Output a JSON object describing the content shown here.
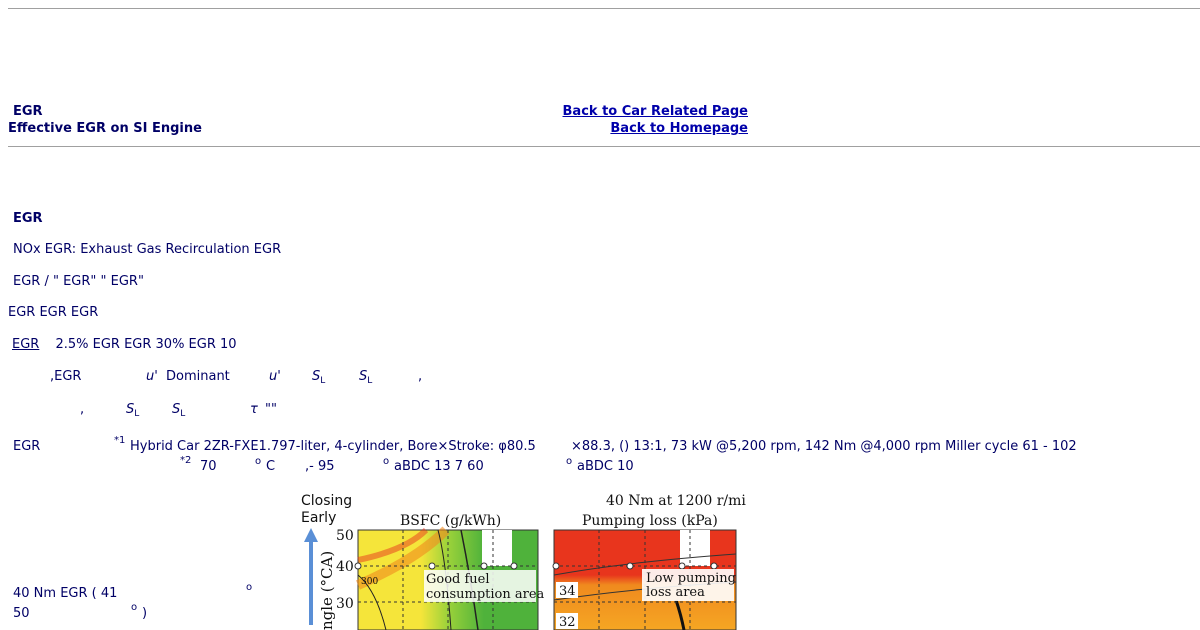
{
  "header": {
    "title": "EGR",
    "subtitle": "Effective EGR on SI Engine",
    "link_car": "Back to Car Related Page",
    "link_home": "Back to Homepage"
  },
  "body": {
    "heading": "EGR",
    "p1": "NOx  EGR: Exhaust Gas Recirculation  EGR",
    "p2": "EGR / \" EGR\"  \" EGR\"",
    "p3": "EGR  EGR  EGR",
    "p4_link": "EGR",
    "p4_rest": "2.5% EGR  EGR  30% EGR  10",
    "p5": {
      "a": ",EGR",
      "b": "u'",
      "c": "Dominant",
      "d": "u'",
      "e_main": "S",
      "e_sub": "L",
      "f_main": "S",
      "f_sub": "L",
      "g": ","
    },
    "p6": {
      "a": ",",
      "b_main": "S",
      "b_sub": "L",
      "c_main": "S",
      "c_sub": "L",
      "d": "τ",
      "e": "\"\""
    },
    "p7": {
      "label": "EGR",
      "sup1": "*1",
      "line1": "Hybrid Car  2ZR-FXE1.797-liter, 4-cylinder, Bore×Stroke: φ80.5",
      "line1b": "×88.3,  () 13:1, 73 kW @5,200 rpm, 142 Nm @4,000 rpm  Miller cycle  61 - 102",
      "sup2": "*2",
      "line2a": "70",
      "deg1": "o",
      "line2b": "C",
      "line2c": ",- 95",
      "deg2": "o",
      "line2d": "aBDC  13  7  60",
      "deg3": "o",
      "line2e": "aBDC  10"
    },
    "p8": {
      "line1": "40 Nm  EGR ( 41",
      "deg": "o",
      "line2": "50",
      "deg2": "o",
      "line2b": ")"
    }
  },
  "figure": {
    "top_title": "40 Nm at 1200 r/min",
    "closing": "Closing",
    "early": "Early",
    "axis_label": "ngle (°CA)",
    "left_panel_title": "BSFC (g/kWh)",
    "right_panel_title": "Pumping loss (kPa)",
    "left_note_1": "Good fuel",
    "left_note_2": "consumption area",
    "right_note_1": "Low pumping",
    "right_note_2": "loss area",
    "contour_300": "300",
    "contour_34": "34",
    "contour_32": "32",
    "ticks": [
      "50",
      "40",
      "30"
    ],
    "colors": {
      "red": "#e8351d",
      "orange": "#f08a1e",
      "yellow": "#f5e53a",
      "green": "#4fb23b",
      "lightgreen": "#9bd23a"
    }
  }
}
